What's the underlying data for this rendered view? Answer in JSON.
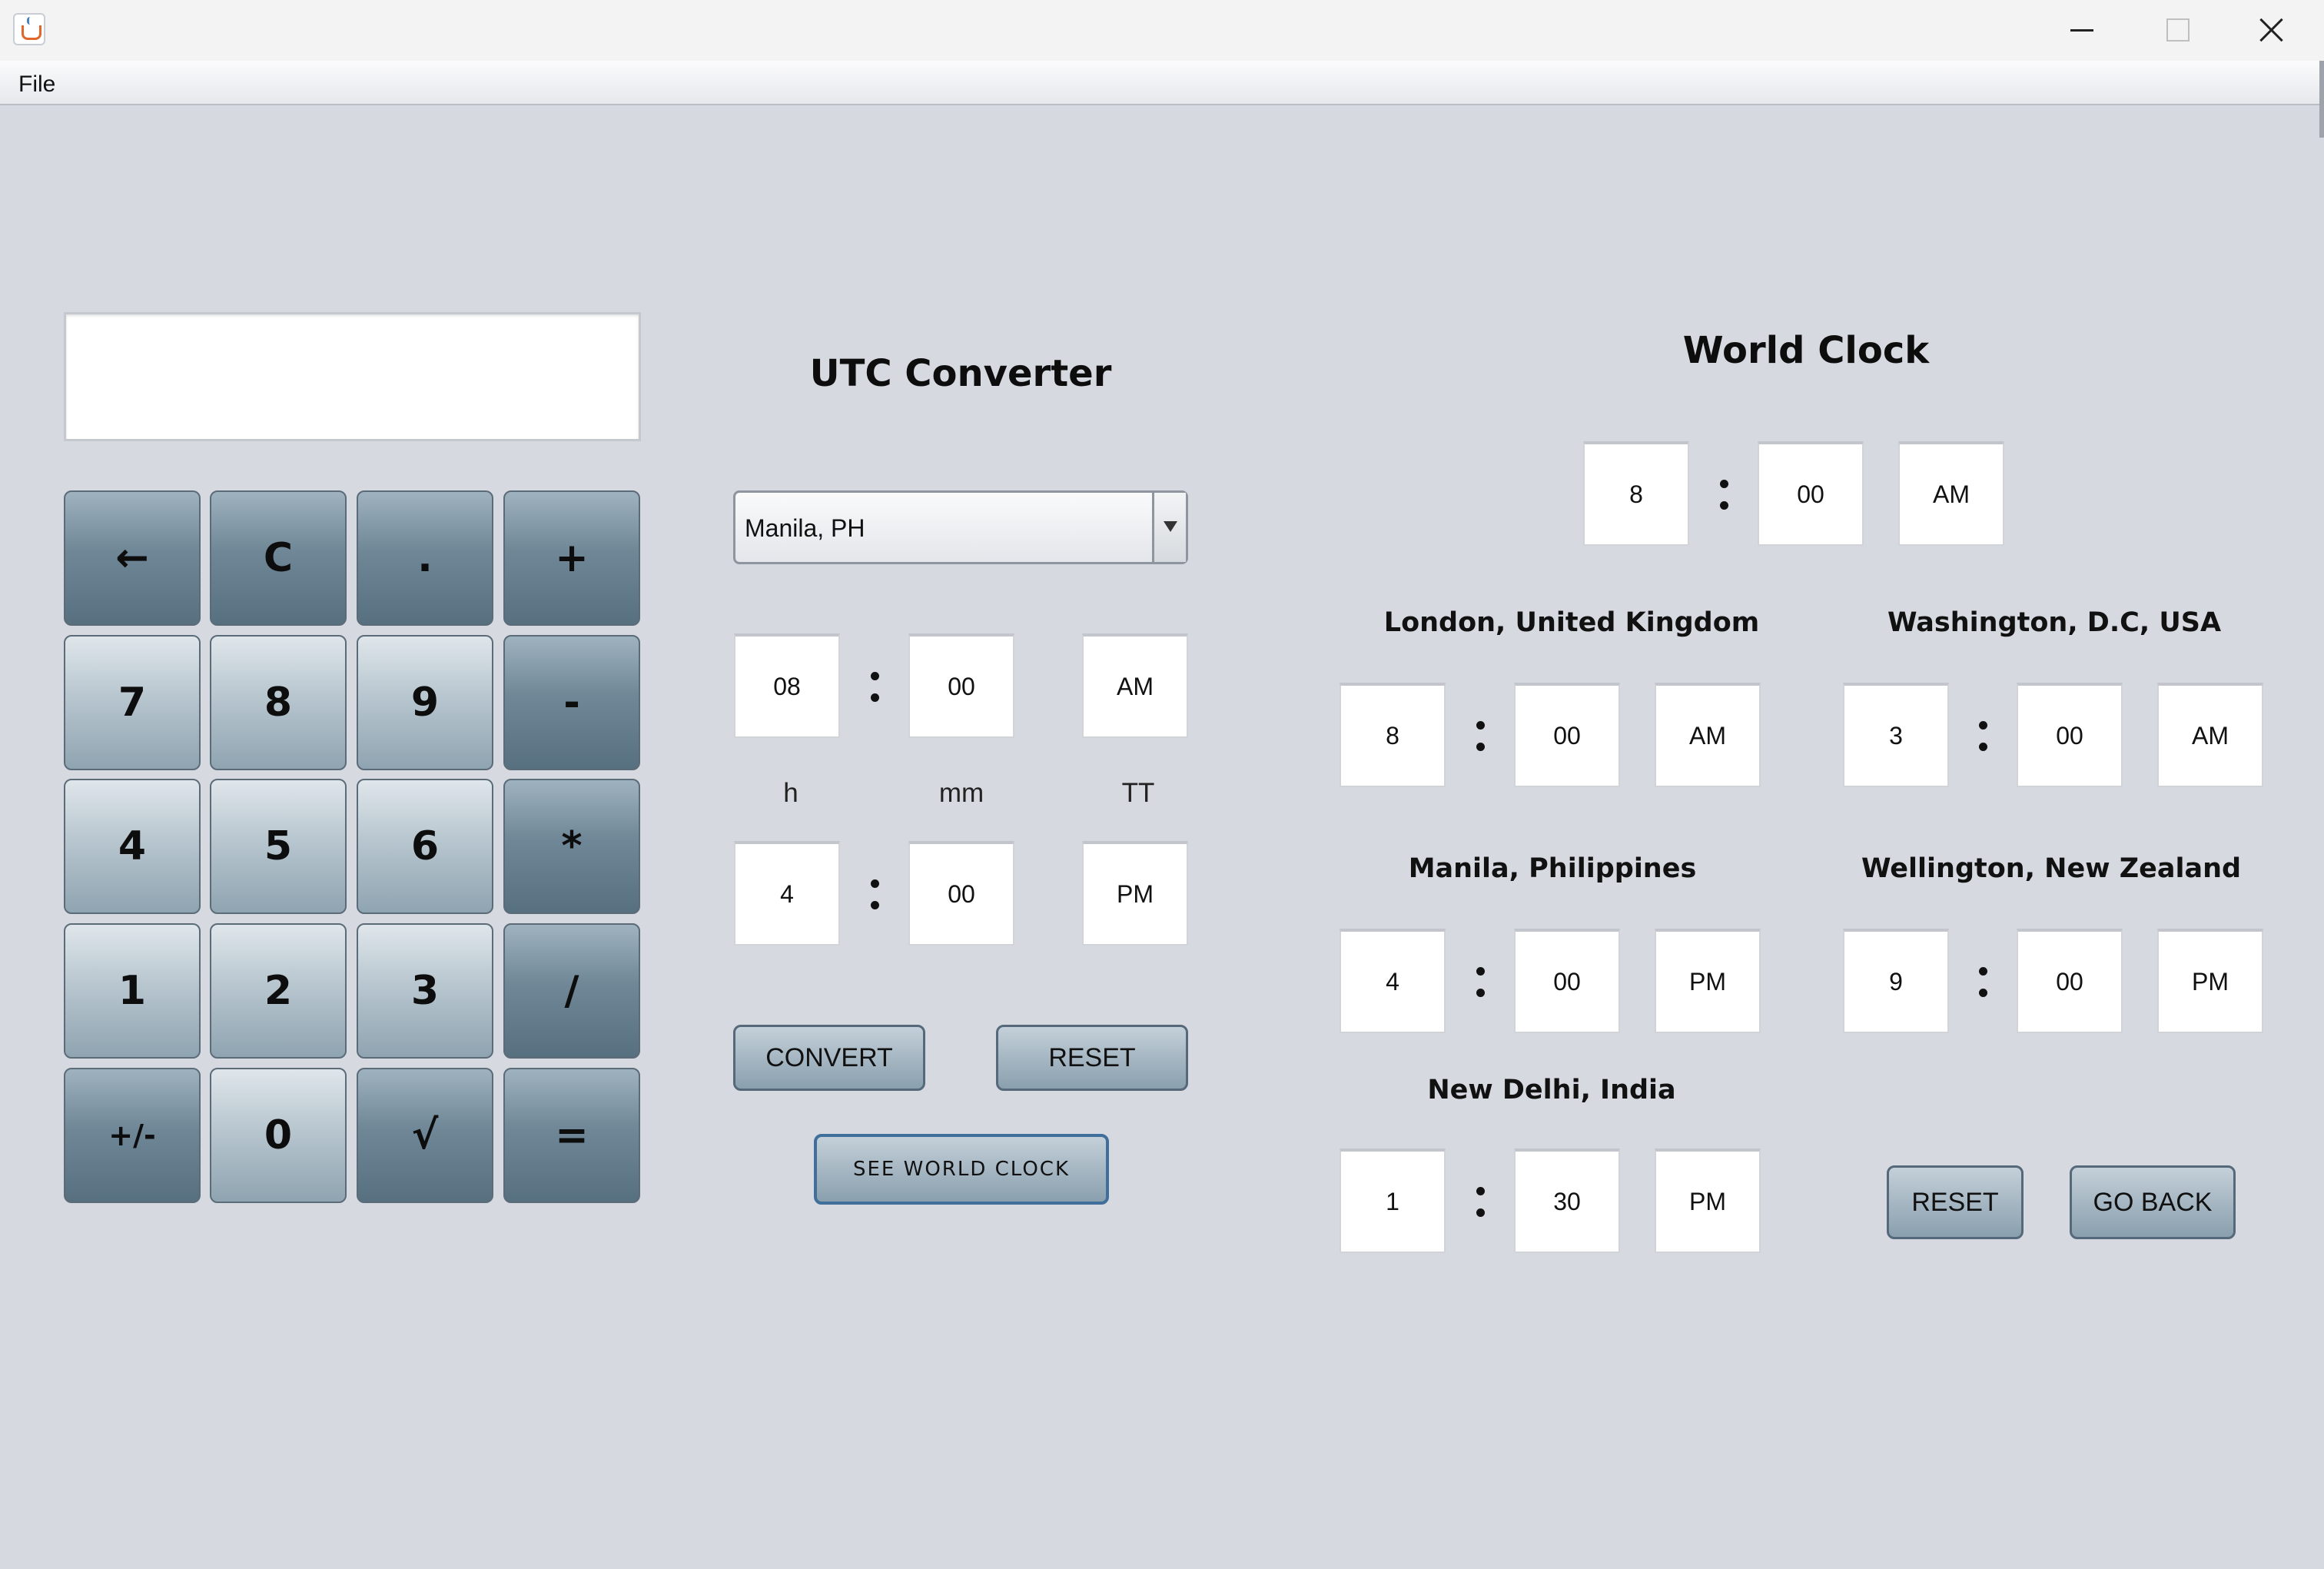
{
  "window": {
    "title": ""
  },
  "menu": {
    "file": "File"
  },
  "calculator": {
    "display": "",
    "keys": [
      "←",
      "C",
      ".",
      "+",
      "7",
      "8",
      "9",
      "-",
      "4",
      "5",
      "6",
      "*",
      "1",
      "2",
      "3",
      "/",
      "+/-",
      "0",
      "√",
      "="
    ]
  },
  "utc_converter": {
    "title": "UTC Converter",
    "selected_zone": "Manila, PH",
    "input_time": {
      "h": "08",
      "m": "00",
      "tt": "AM"
    },
    "labels": {
      "h": "h",
      "mm": "mm",
      "tt": "TT"
    },
    "output_time": {
      "h": "4",
      "m": "00",
      "tt": "PM"
    },
    "convert_label": "CONVERT",
    "reset_label": "RESET",
    "see_world_clock_label": "SEE WORLD CLOCK"
  },
  "world_clock": {
    "title": "World Clock",
    "main_time": {
      "h": "8",
      "m": "00",
      "tt": "AM"
    },
    "cities": [
      {
        "name": "London, United Kingdom",
        "h": "8",
        "m": "00",
        "tt": "AM"
      },
      {
        "name": "Washington, D.C, USA",
        "h": "3",
        "m": "00",
        "tt": "AM"
      },
      {
        "name": "Manila, Philippines",
        "h": "4",
        "m": "00",
        "tt": "PM"
      },
      {
        "name": "Wellington, New Zealand",
        "h": "9",
        "m": "00",
        "tt": "PM"
      },
      {
        "name": "New Delhi, India",
        "h": "1",
        "m": "30",
        "tt": "PM"
      }
    ],
    "reset_label": "RESET",
    "go_back_label": "GO BACK"
  },
  "colors": {
    "background": "#d6d9e0",
    "key_dark": "#6f8796",
    "key_light": "#b8c6cf"
  }
}
